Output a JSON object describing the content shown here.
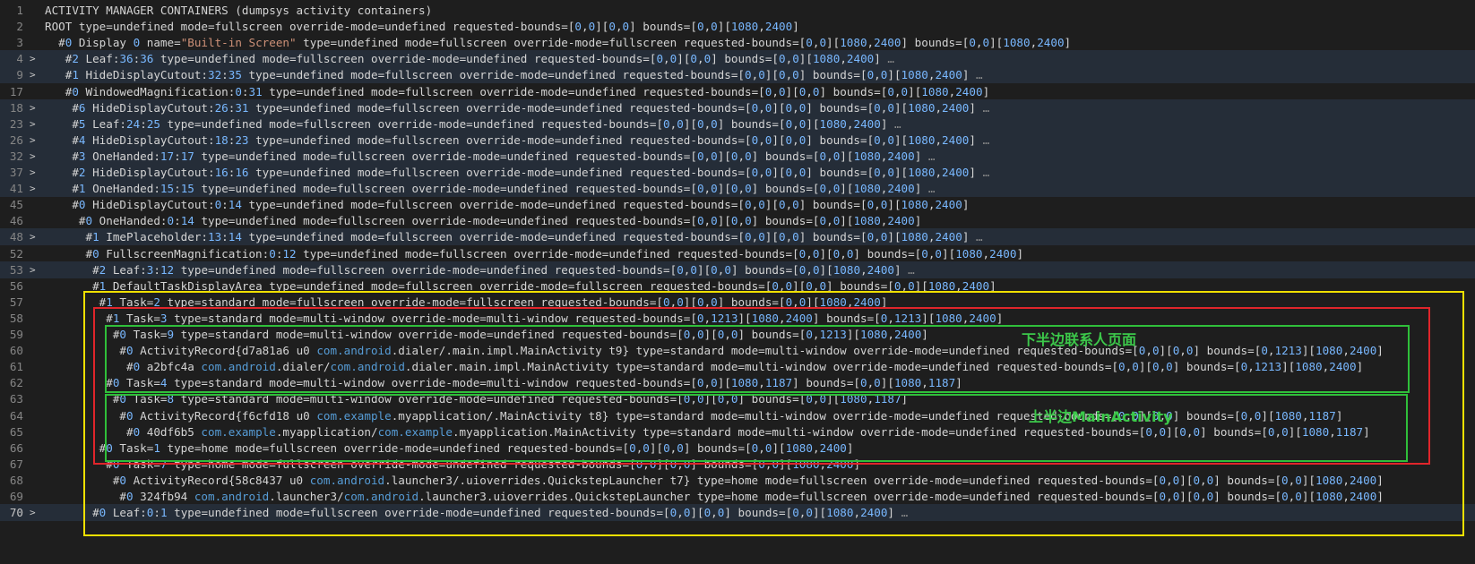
{
  "colors": {
    "yellow_box": "#f0e000",
    "red_box": "#e0252b",
    "green_box": "#2fbf3a",
    "annotation": "#3cc84a"
  },
  "annotations": {
    "bottom_contacts": "下半边联系人页面",
    "top_main_activity": "上半边MainActivity"
  },
  "lines": [
    {
      "n": "1",
      "fold": "",
      "html": "ACTIVITY MANAGER CONTAINERS (dumpsys activity containers)"
    },
    {
      "n": "2",
      "fold": "",
      "html": "ROOT type=undefined mode=fullscreen override-mode=undefined requested-bounds=[0,0][0,0] bounds=[0,0][1080,2400]"
    },
    {
      "n": "3",
      "fold": "",
      "html": "  #0 Display 0 name=\"Built-in Screen\" type=undefined mode=fullscreen override-mode=fullscreen requested-bounds=[0,0][1080,2400] bounds=[0,0][1080,2400]"
    },
    {
      "n": "4",
      "fold": ">",
      "html": "   #2 Leaf:36:36 type=undefined mode=fullscreen override-mode=undefined requested-bounds=[0,0][0,0] bounds=[0,0][1080,2400] …"
    },
    {
      "n": "9",
      "fold": ">",
      "html": "   #1 HideDisplayCutout:32:35 type=undefined mode=fullscreen override-mode=undefined requested-bounds=[0,0][0,0] bounds=[0,0][1080,2400] …"
    },
    {
      "n": "17",
      "fold": "",
      "html": "   #0 WindowedMagnification:0:31 type=undefined mode=fullscreen override-mode=undefined requested-bounds=[0,0][0,0] bounds=[0,0][1080,2400]"
    },
    {
      "n": "18",
      "fold": ">",
      "html": "    #6 HideDisplayCutout:26:31 type=undefined mode=fullscreen override-mode=undefined requested-bounds=[0,0][0,0] bounds=[0,0][1080,2400] …"
    },
    {
      "n": "23",
      "fold": ">",
      "html": "    #5 Leaf:24:25 type=undefined mode=fullscreen override-mode=undefined requested-bounds=[0,0][0,0] bounds=[0,0][1080,2400] …"
    },
    {
      "n": "26",
      "fold": ">",
      "html": "    #4 HideDisplayCutout:18:23 type=undefined mode=fullscreen override-mode=undefined requested-bounds=[0,0][0,0] bounds=[0,0][1080,2400] …"
    },
    {
      "n": "32",
      "fold": ">",
      "html": "    #3 OneHanded:17:17 type=undefined mode=fullscreen override-mode=undefined requested-bounds=[0,0][0,0] bounds=[0,0][1080,2400] …"
    },
    {
      "n": "37",
      "fold": ">",
      "html": "    #2 HideDisplayCutout:16:16 type=undefined mode=fullscreen override-mode=undefined requested-bounds=[0,0][0,0] bounds=[0,0][1080,2400] …"
    },
    {
      "n": "41",
      "fold": ">",
      "html": "    #1 OneHanded:15:15 type=undefined mode=fullscreen override-mode=undefined requested-bounds=[0,0][0,0] bounds=[0,0][1080,2400] …"
    },
    {
      "n": "45",
      "fold": "",
      "html": "    #0 HideDisplayCutout:0:14 type=undefined mode=fullscreen override-mode=undefined requested-bounds=[0,0][0,0] bounds=[0,0][1080,2400]"
    },
    {
      "n": "46",
      "fold": "",
      "html": "     #0 OneHanded:0:14 type=undefined mode=fullscreen override-mode=undefined requested-bounds=[0,0][0,0] bounds=[0,0][1080,2400]"
    },
    {
      "n": "48",
      "fold": ">",
      "html": "      #1 ImePlaceholder:13:14 type=undefined mode=fullscreen override-mode=undefined requested-bounds=[0,0][0,0] bounds=[0,0][1080,2400] …"
    },
    {
      "n": "52",
      "fold": "",
      "html": "      #0 FullscreenMagnification:0:12 type=undefined mode=fullscreen override-mode=undefined requested-bounds=[0,0][0,0] bounds=[0,0][1080,2400]"
    },
    {
      "n": "53",
      "fold": ">",
      "html": "       #2 Leaf:3:12 type=undefined mode=fullscreen override-mode=undefined requested-bounds=[0,0][0,0] bounds=[0,0][1080,2400] …"
    },
    {
      "n": "56",
      "fold": "",
      "html": "       #1 DefaultTaskDisplayArea type=undefined mode=fullscreen override-mode=fullscreen requested-bounds=[0,0][0,0] bounds=[0,0][1080,2400]"
    },
    {
      "n": "57",
      "fold": "",
      "html": "        #1 Task=2 type=standard mode=fullscreen override-mode=fullscreen requested-bounds=[0,0][0,0] bounds=[0,0][1080,2400]"
    },
    {
      "n": "58",
      "fold": "",
      "html": "         #1 Task=3 type=standard mode=multi-window override-mode=multi-window requested-bounds=[0,1213][1080,2400] bounds=[0,1213][1080,2400]"
    },
    {
      "n": "59",
      "fold": "",
      "html": "          #0 Task=9 type=standard mode=multi-window override-mode=undefined requested-bounds=[0,0][0,0] bounds=[0,1213][1080,2400]"
    },
    {
      "n": "60",
      "fold": "",
      "html": "           #0 ActivityRecord{d7a81a6 u0 com.android.dialer/.main.impl.MainActivity t9} type=standard mode=multi-window override-mode=undefined requested-bounds=[0,0][0,0] bounds=[0,1213][1080,2400]"
    },
    {
      "n": "61",
      "fold": "",
      "html": "            #0 a2bfc4a com.android.dialer/com.android.dialer.main.impl.MainActivity type=standard mode=multi-window override-mode=undefined requested-bounds=[0,0][0,0] bounds=[0,1213][1080,2400]"
    },
    {
      "n": "62",
      "fold": "",
      "html": "         #0 Task=4 type=standard mode=multi-window override-mode=multi-window requested-bounds=[0,0][1080,1187] bounds=[0,0][1080,1187]"
    },
    {
      "n": "63",
      "fold": "",
      "html": "          #0 Task=8 type=standard mode=multi-window override-mode=undefined requested-bounds=[0,0][0,0] bounds=[0,0][1080,1187]"
    },
    {
      "n": "64",
      "fold": "",
      "html": "           #0 ActivityRecord{f6cfd18 u0 com.example.myapplication/.MainActivity t8} type=standard mode=multi-window override-mode=undefined requested-bounds=[0,0][0,0] bounds=[0,0][1080,1187]"
    },
    {
      "n": "65",
      "fold": "",
      "html": "            #0 40df6b5 com.example.myapplication/com.example.myapplication.MainActivity type=standard mode=multi-window override-mode=undefined requested-bounds=[0,0][0,0] bounds=[0,0][1080,1187]"
    },
    {
      "n": "66",
      "fold": "",
      "html": "        #0 Task=1 type=home mode=fullscreen override-mode=undefined requested-bounds=[0,0][0,0] bounds=[0,0][1080,2400]"
    },
    {
      "n": "67",
      "fold": "",
      "html": "         #0 Task=7 type=home mode=fullscreen override-mode=undefined requested-bounds=[0,0][0,0] bounds=[0,0][1080,2400]"
    },
    {
      "n": "68",
      "fold": "",
      "html": "          #0 ActivityRecord{58c8437 u0 com.android.launcher3/.uioverrides.QuickstepLauncher t7} type=home mode=fullscreen override-mode=undefined requested-bounds=[0,0][0,0] bounds=[0,0][1080,2400]"
    },
    {
      "n": "69",
      "fold": "",
      "html": "           #0 324fb94 com.android.launcher3/com.android.launcher3.uioverrides.QuickstepLauncher type=home mode=fullscreen override-mode=undefined requested-bounds=[0,0][0,0] bounds=[0,0][1080,2400]"
    },
    {
      "n": "70",
      "fold": ">",
      "html": "       #0 Leaf:0:1 type=undefined mode=fullscreen override-mode=undefined requested-bounds=[0,0][0,0] bounds=[0,0][1080,2400] …"
    }
  ]
}
